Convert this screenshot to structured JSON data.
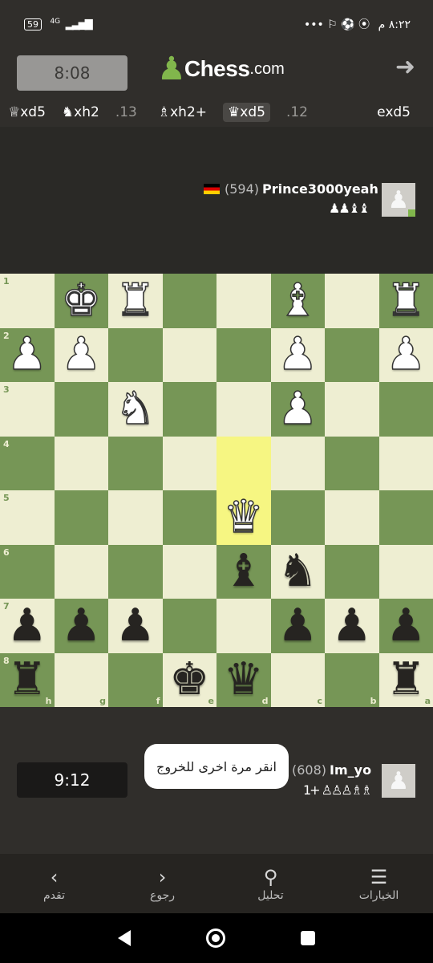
{
  "status_bar": {
    "battery": "59",
    "network": "4G",
    "right_icons": "••• ⚐ ⚽ ⦿",
    "time": "٨:٢٢ م"
  },
  "header": {
    "logo_word": "Chess",
    "logo_suffix": ".com"
  },
  "moves": {
    "items": [
      {
        "text": "♕xd5",
        "type": "move"
      },
      {
        "text": "♞xh2",
        "type": "move"
      },
      {
        "text": ".13",
        "type": "num"
      },
      {
        "text": "♗xh2+",
        "type": "move"
      },
      {
        "text": "♛xd5",
        "type": "move",
        "active": true
      },
      {
        "text": ".12",
        "type": "num"
      },
      {
        "text": "exd5",
        "type": "move"
      }
    ]
  },
  "top_player": {
    "clock": "8:08",
    "rating": "(594)",
    "name": "Prince3000yeah",
    "captured": "♟♟♝♝"
  },
  "bottom_player": {
    "clock": "9:12",
    "rating": "(608)",
    "name": "Im_yo",
    "captured": "1+ ♙♙♙♗♗"
  },
  "toast": "انقر مرة اخرى للخروج",
  "board": {
    "ranks_left": [
      "1",
      "2",
      "3",
      "4",
      "5",
      "6",
      "7",
      "8"
    ],
    "files_bottom": [
      "h",
      "g",
      "f",
      "e",
      "d",
      "c",
      "b",
      "a"
    ],
    "highlight": [
      "3,4",
      "4,4"
    ],
    "rows": [
      [
        "",
        "wK",
        "wR",
        "",
        "",
        "wB",
        "",
        "wR"
      ],
      [
        "wP",
        "wP",
        "",
        "",
        "",
        "wP",
        "",
        "wP"
      ],
      [
        "",
        "",
        "wN",
        "",
        "",
        "wP",
        "",
        ""
      ],
      [
        "",
        "",
        "",
        "",
        "",
        "",
        "",
        ""
      ],
      [
        "",
        "",
        "",
        "",
        "wQ",
        "",
        "",
        ""
      ],
      [
        "",
        "",
        "",
        "",
        "bB",
        "bN",
        "",
        ""
      ],
      [
        "bP",
        "bP",
        "bP",
        "",
        "",
        "bP",
        "bP",
        "bP"
      ],
      [
        "bR",
        "",
        "",
        "bK",
        "bQ",
        "",
        "",
        "bR"
      ]
    ]
  },
  "nav": {
    "items": [
      {
        "label": "تقدم",
        "icon": "chevron-left-icon",
        "glyph": "‹"
      },
      {
        "label": "رجوع",
        "icon": "chevron-right-icon",
        "glyph": "›"
      },
      {
        "label": "تحليل",
        "icon": "analysis-icon",
        "glyph": "⚲"
      },
      {
        "label": "الخيارات",
        "icon": "menu-list-icon",
        "glyph": "☰"
      }
    ]
  }
}
